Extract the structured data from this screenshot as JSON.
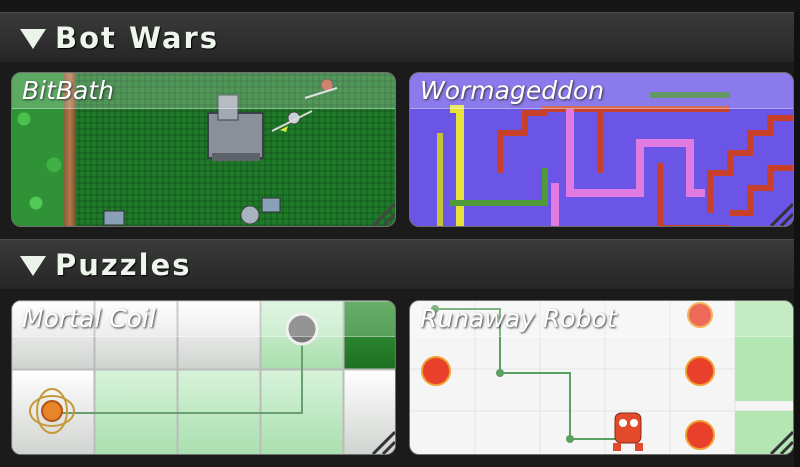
{
  "sections": [
    {
      "title": "Bot Wars",
      "games": [
        {
          "title": "BitBath"
        },
        {
          "title": "Wormageddon"
        }
      ]
    },
    {
      "title": "Puzzles",
      "games": [
        {
          "title": "Mortal Coil"
        },
        {
          "title": "Runaway Robot"
        }
      ]
    }
  ],
  "icons": {
    "collapse": "triangle-down-icon",
    "corner": "resize-corner-icon"
  }
}
